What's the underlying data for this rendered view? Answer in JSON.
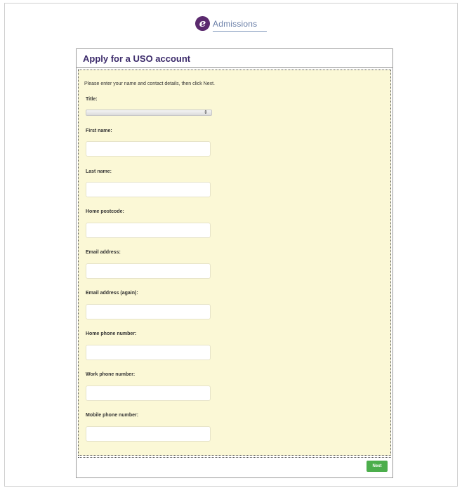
{
  "brand": {
    "logo_letter": "e",
    "name": "Admissions"
  },
  "form": {
    "title": "Apply for a USO account",
    "intro": "Please enter your name and contact details, then click Next.",
    "fields": {
      "title": {
        "label": "Title:",
        "value": "",
        "arrow": "⇕"
      },
      "first_name": {
        "label": "First name:",
        "value": ""
      },
      "last_name": {
        "label": "Last name:",
        "value": ""
      },
      "home_postcode": {
        "label": "Home postcode:",
        "value": ""
      },
      "email": {
        "label": "Email address:",
        "value": ""
      },
      "email_again": {
        "label": "Email address (again):",
        "value": ""
      },
      "home_phone": {
        "label": "Home phone number:",
        "value": ""
      },
      "work_phone": {
        "label": "Work phone number:",
        "value": ""
      },
      "mobile_phone": {
        "label": "Mobile phone number:",
        "value": ""
      }
    },
    "next_label": "Next"
  },
  "colors": {
    "form_background": "#fbf8d6",
    "title_text": "#3b2a6a",
    "logo_purple": "#5b2a6e",
    "next_button": "#4cae4c"
  }
}
